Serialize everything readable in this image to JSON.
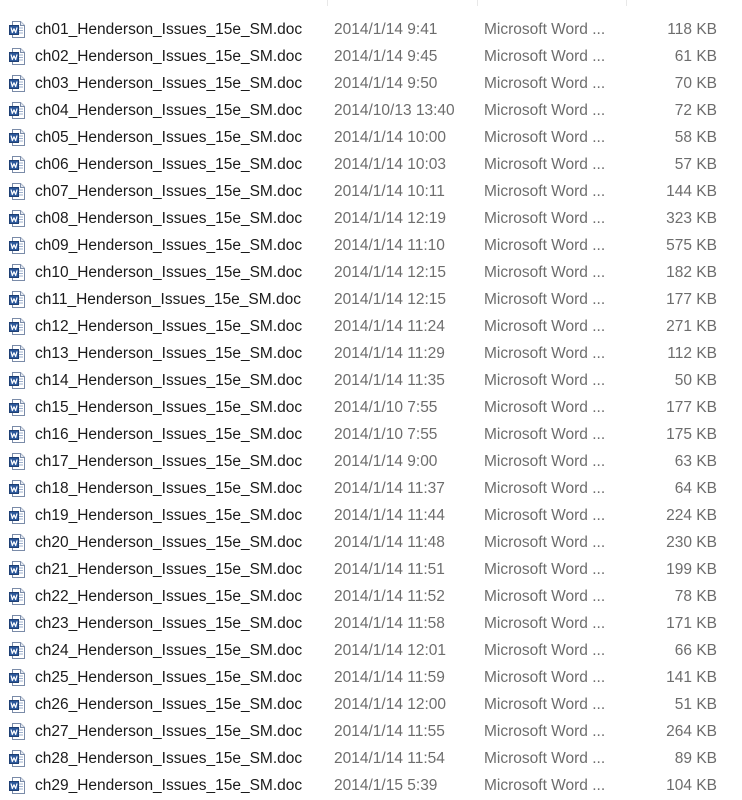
{
  "file_type_label": "Microsoft Word ...",
  "files": [
    {
      "name": "ch01_Henderson_Issues_15e_SM.doc",
      "modified": "2014/1/14 9:41",
      "size": "118 KB"
    },
    {
      "name": "ch02_Henderson_Issues_15e_SM.doc",
      "modified": "2014/1/14 9:45",
      "size": "61 KB"
    },
    {
      "name": "ch03_Henderson_Issues_15e_SM.doc",
      "modified": "2014/1/14 9:50",
      "size": "70 KB"
    },
    {
      "name": "ch04_Henderson_Issues_15e_SM.doc",
      "modified": "2014/10/13 13:40",
      "size": "72 KB"
    },
    {
      "name": "ch05_Henderson_Issues_15e_SM.doc",
      "modified": "2014/1/14 10:00",
      "size": "58 KB"
    },
    {
      "name": "ch06_Henderson_Issues_15e_SM.doc",
      "modified": "2014/1/14 10:03",
      "size": "57 KB"
    },
    {
      "name": "ch07_Henderson_Issues_15e_SM.doc",
      "modified": "2014/1/14 10:11",
      "size": "144 KB"
    },
    {
      "name": "ch08_Henderson_Issues_15e_SM.doc",
      "modified": "2014/1/14 12:19",
      "size": "323 KB"
    },
    {
      "name": "ch09_Henderson_Issues_15e_SM.doc",
      "modified": "2014/1/14 11:10",
      "size": "575 KB"
    },
    {
      "name": "ch10_Henderson_Issues_15e_SM.doc",
      "modified": "2014/1/14 12:15",
      "size": "182 KB"
    },
    {
      "name": "ch11_Henderson_Issues_15e_SM.doc",
      "modified": "2014/1/14 12:15",
      "size": "177 KB"
    },
    {
      "name": "ch12_Henderson_Issues_15e_SM.doc",
      "modified": "2014/1/14 11:24",
      "size": "271 KB"
    },
    {
      "name": "ch13_Henderson_Issues_15e_SM.doc",
      "modified": "2014/1/14 11:29",
      "size": "112 KB"
    },
    {
      "name": "ch14_Henderson_Issues_15e_SM.doc",
      "modified": "2014/1/14 11:35",
      "size": "50 KB"
    },
    {
      "name": "ch15_Henderson_Issues_15e_SM.doc",
      "modified": "2014/1/10 7:55",
      "size": "177 KB"
    },
    {
      "name": "ch16_Henderson_Issues_15e_SM.doc",
      "modified": "2014/1/10 7:55",
      "size": "175 KB"
    },
    {
      "name": "ch17_Henderson_Issues_15e_SM.doc",
      "modified": "2014/1/14 9:00",
      "size": "63 KB"
    },
    {
      "name": "ch18_Henderson_Issues_15e_SM.doc",
      "modified": "2014/1/14 11:37",
      "size": "64 KB"
    },
    {
      "name": "ch19_Henderson_Issues_15e_SM.doc",
      "modified": "2014/1/14 11:44",
      "size": "224 KB"
    },
    {
      "name": "ch20_Henderson_Issues_15e_SM.doc",
      "modified": "2014/1/14 11:48",
      "size": "230 KB"
    },
    {
      "name": "ch21_Henderson_Issues_15e_SM.doc",
      "modified": "2014/1/14 11:51",
      "size": "199 KB"
    },
    {
      "name": "ch22_Henderson_Issues_15e_SM.doc",
      "modified": "2014/1/14 11:52",
      "size": "78 KB"
    },
    {
      "name": "ch23_Henderson_Issues_15e_SM.doc",
      "modified": "2014/1/14 11:58",
      "size": "171 KB"
    },
    {
      "name": "ch24_Henderson_Issues_15e_SM.doc",
      "modified": "2014/1/14 12:01",
      "size": "66 KB"
    },
    {
      "name": "ch25_Henderson_Issues_15e_SM.doc",
      "modified": "2014/1/14 11:59",
      "size": "141 KB"
    },
    {
      "name": "ch26_Henderson_Issues_15e_SM.doc",
      "modified": "2014/1/14 12:00",
      "size": "51 KB"
    },
    {
      "name": "ch27_Henderson_Issues_15e_SM.doc",
      "modified": "2014/1/14 11:55",
      "size": "264 KB"
    },
    {
      "name": "ch28_Henderson_Issues_15e_SM.doc",
      "modified": "2014/1/14 11:54",
      "size": "89 KB"
    },
    {
      "name": "ch29_Henderson_Issues_15e_SM.doc",
      "modified": "2014/1/15 5:39",
      "size": "104 KB"
    }
  ],
  "icons": {
    "file": "word-document-icon"
  },
  "colors": {
    "name_text": "#1a1a1a",
    "meta_text": "#6d6d6d",
    "icon_blue": "#2b579a",
    "background": "#ffffff"
  }
}
